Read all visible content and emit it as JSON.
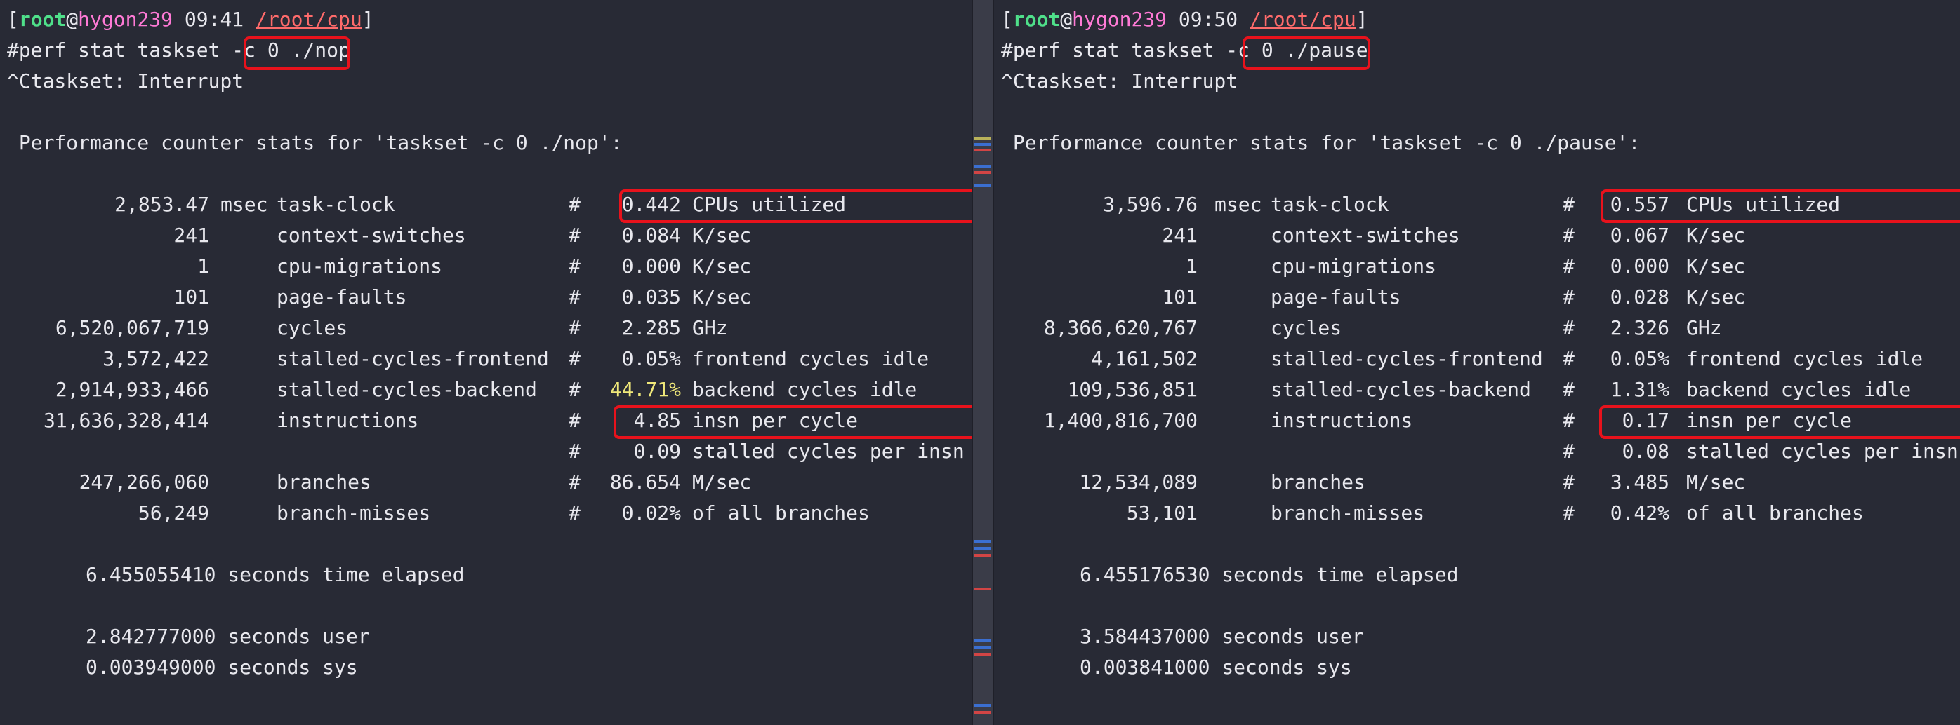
{
  "left": {
    "prompt": {
      "open": "[",
      "user": "root",
      "at": "@",
      "host": "hygon239",
      "time": "09:41",
      "path": "/root/cpu",
      "close": "]"
    },
    "command_prefix": "#perf stat taskset -c",
    "command_arg": "0 ./nop",
    "interrupt": "^Ctaskset: Interrupt",
    "header": " Performance counter stats for 'taskset -c 0 ./nop':",
    "rows": [
      {
        "value": "2,853.47",
        "unit": "msec",
        "event": "task-clock",
        "hash": "#",
        "stat": "0.442",
        "desc": "CPUs utilized"
      },
      {
        "value": "241",
        "unit": "",
        "event": "context-switches",
        "hash": "#",
        "stat": "0.084",
        "desc": "K/sec"
      },
      {
        "value": "1",
        "unit": "",
        "event": "cpu-migrations",
        "hash": "#",
        "stat": "0.000",
        "desc": "K/sec"
      },
      {
        "value": "101",
        "unit": "",
        "event": "page-faults",
        "hash": "#",
        "stat": "0.035",
        "desc": "K/sec"
      },
      {
        "value": "6,520,067,719",
        "unit": "",
        "event": "cycles",
        "hash": "#",
        "stat": "2.285",
        "desc": "GHz"
      },
      {
        "value": "3,572,422",
        "unit": "",
        "event": "stalled-cycles-frontend",
        "hash": "#",
        "stat": "0.05%",
        "desc": "frontend cycles idle"
      },
      {
        "value": "2,914,933,466",
        "unit": "",
        "event": "stalled-cycles-backend",
        "hash": "#",
        "stat": "44.71%",
        "desc": "backend cycles idle"
      },
      {
        "value": "31,636,328,414",
        "unit": "",
        "event": "instructions",
        "hash": "#",
        "stat": "4.85",
        "desc": "insn per cycle"
      },
      {
        "value": "",
        "unit": "",
        "event": "",
        "hash": "#",
        "stat": "0.09",
        "desc": "stalled cycles per insn"
      },
      {
        "value": "247,266,060",
        "unit": "",
        "event": "branches",
        "hash": "#",
        "stat": "86.654",
        "desc": "M/sec"
      },
      {
        "value": "56,249",
        "unit": "",
        "event": "branch-misses",
        "hash": "#",
        "stat": "0.02%",
        "desc": "of all branches"
      }
    ],
    "elapsed": "6.455055410 seconds time elapsed",
    "user": "2.842777000 seconds user",
    "sys": "0.003949000 seconds sys"
  },
  "right": {
    "prompt": {
      "open": "[",
      "user": "root",
      "at": "@",
      "host": "hygon239",
      "time": "09:50",
      "path": "/root/cpu",
      "close": "]"
    },
    "command_prefix": "#perf stat taskset -c",
    "command_arg": "0 ./pause",
    "interrupt": "^Ctaskset: Interrupt",
    "header": " Performance counter stats for 'taskset -c 0 ./pause':",
    "rows": [
      {
        "value": "3,596.76",
        "unit": "msec",
        "event": "task-clock",
        "hash": "#",
        "stat": "0.557",
        "desc": "CPUs utilized"
      },
      {
        "value": "241",
        "unit": "",
        "event": "context-switches",
        "hash": "#",
        "stat": "0.067",
        "desc": "K/sec"
      },
      {
        "value": "1",
        "unit": "",
        "event": "cpu-migrations",
        "hash": "#",
        "stat": "0.000",
        "desc": "K/sec"
      },
      {
        "value": "101",
        "unit": "",
        "event": "page-faults",
        "hash": "#",
        "stat": "0.028",
        "desc": "K/sec"
      },
      {
        "value": "8,366,620,767",
        "unit": "",
        "event": "cycles",
        "hash": "#",
        "stat": "2.326",
        "desc": "GHz"
      },
      {
        "value": "4,161,502",
        "unit": "",
        "event": "stalled-cycles-frontend",
        "hash": "#",
        "stat": "0.05%",
        "desc": "frontend cycles idle"
      },
      {
        "value": "109,536,851",
        "unit": "",
        "event": "stalled-cycles-backend",
        "hash": "#",
        "stat": "1.31%",
        "desc": "backend cycles idle"
      },
      {
        "value": "1,400,816,700",
        "unit": "",
        "event": "instructions",
        "hash": "#",
        "stat": "0.17",
        "desc": "insn per cycle"
      },
      {
        "value": "",
        "unit": "",
        "event": "",
        "hash": "#",
        "stat": "0.08",
        "desc": "stalled cycles per insn"
      },
      {
        "value": "12,534,089",
        "unit": "",
        "event": "branches",
        "hash": "#",
        "stat": "3.485",
        "desc": "M/sec"
      },
      {
        "value": "53,101",
        "unit": "",
        "event": "branch-misses",
        "hash": "#",
        "stat": "0.42%",
        "desc": "of all branches"
      }
    ],
    "elapsed": "6.455176530 seconds time elapsed",
    "user": "3.584437000 seconds user",
    "sys": "0.003841000 seconds sys"
  },
  "colors": {
    "background": "#282a35",
    "prompt_user": "#4fe08a",
    "prompt_host": "#ff7ad6",
    "prompt_path": "#ff6b6b",
    "highlight_box": "#e8121c",
    "warning_value": "#f0e87a"
  }
}
